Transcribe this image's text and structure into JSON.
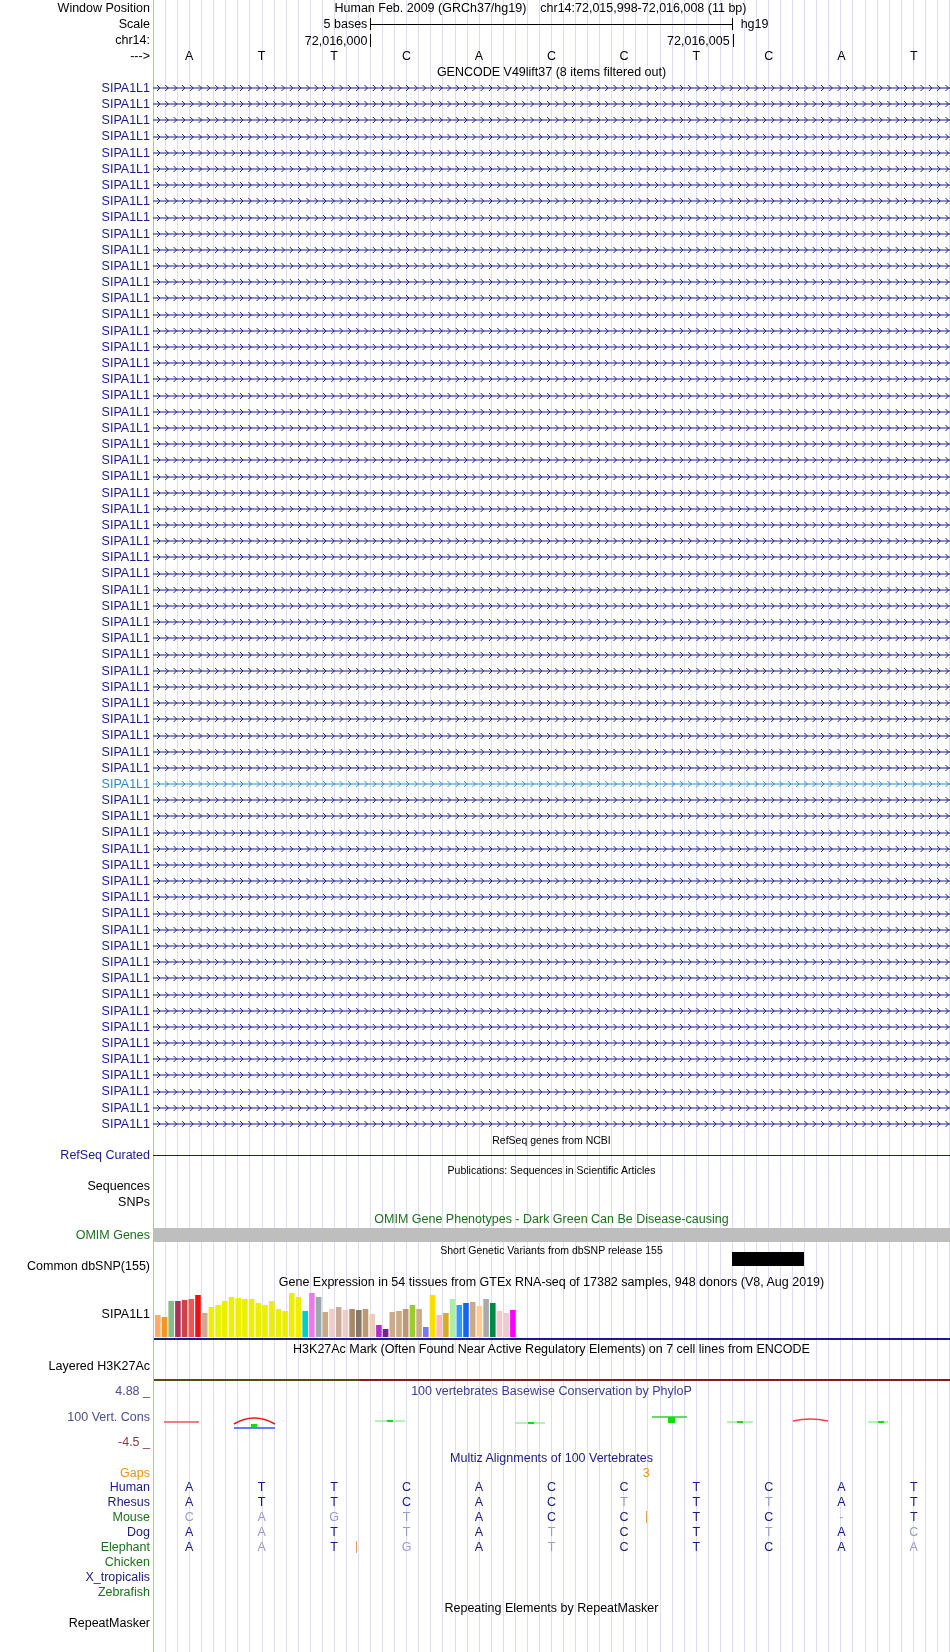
{
  "header": {
    "window_position_label": "Window Position",
    "assembly": "Human Feb. 2009 (GRCh37/hg19)",
    "position": "chr14:72,015,998-72,016,008 (11 bp)",
    "scale_label": "Scale",
    "scale_text": "5 bases",
    "scale_db": "hg19",
    "chrom_label": "chr14:",
    "ticks": [
      "72,016,000",
      "72,016,005"
    ],
    "strand_label": "--->",
    "bases": [
      "A",
      "T",
      "T",
      "C",
      "A",
      "C",
      "C",
      "T",
      "C",
      "A",
      "T"
    ]
  },
  "gencode": {
    "title": "GENCODE V49lift37 (8 items filtered out)",
    "genes": [
      {
        "name": "SIPA1L1",
        "selected": false
      },
      {
        "name": "SIPA1L1",
        "selected": false
      },
      {
        "name": "SIPA1L1",
        "selected": false
      },
      {
        "name": "SIPA1L1",
        "selected": false
      },
      {
        "name": "SIPA1L1",
        "selected": false
      },
      {
        "name": "SIPA1L1",
        "selected": false
      },
      {
        "name": "SIPA1L1",
        "selected": false
      },
      {
        "name": "SIPA1L1",
        "selected": false
      },
      {
        "name": "SIPA1L1",
        "selected": false
      },
      {
        "name": "SIPA1L1",
        "selected": false
      },
      {
        "name": "SIPA1L1",
        "selected": false
      },
      {
        "name": "SIPA1L1",
        "selected": false
      },
      {
        "name": "SIPA1L1",
        "selected": false
      },
      {
        "name": "SIPA1L1",
        "selected": false
      },
      {
        "name": "SIPA1L1",
        "selected": false
      },
      {
        "name": "SIPA1L1",
        "selected": false
      },
      {
        "name": "SIPA1L1",
        "selected": false
      },
      {
        "name": "SIPA1L1",
        "selected": false
      },
      {
        "name": "SIPA1L1",
        "selected": false
      },
      {
        "name": "SIPA1L1",
        "selected": false
      },
      {
        "name": "SIPA1L1",
        "selected": false
      },
      {
        "name": "SIPA1L1",
        "selected": false
      },
      {
        "name": "SIPA1L1",
        "selected": false
      },
      {
        "name": "SIPA1L1",
        "selected": false
      },
      {
        "name": "SIPA1L1",
        "selected": false
      },
      {
        "name": "SIPA1L1",
        "selected": false
      },
      {
        "name": "SIPA1L1",
        "selected": false
      },
      {
        "name": "SIPA1L1",
        "selected": false
      },
      {
        "name": "SIPA1L1",
        "selected": false
      },
      {
        "name": "SIPA1L1",
        "selected": false
      },
      {
        "name": "SIPA1L1",
        "selected": false
      },
      {
        "name": "SIPA1L1",
        "selected": false
      },
      {
        "name": "SIPA1L1",
        "selected": false
      },
      {
        "name": "SIPA1L1",
        "selected": false
      },
      {
        "name": "SIPA1L1",
        "selected": false
      },
      {
        "name": "SIPA1L1",
        "selected": false
      },
      {
        "name": "SIPA1L1",
        "selected": false
      },
      {
        "name": "SIPA1L1",
        "selected": false
      },
      {
        "name": "SIPA1L1",
        "selected": false
      },
      {
        "name": "SIPA1L1",
        "selected": false
      },
      {
        "name": "SIPA1L1",
        "selected": false
      },
      {
        "name": "SIPA1L1",
        "selected": false
      },
      {
        "name": "SIPA1L1",
        "selected": false
      },
      {
        "name": "SIPA1L1",
        "selected": true
      },
      {
        "name": "SIPA1L1",
        "selected": false
      },
      {
        "name": "SIPA1L1",
        "selected": false
      },
      {
        "name": "SIPA1L1",
        "selected": false
      },
      {
        "name": "SIPA1L1",
        "selected": false
      },
      {
        "name": "SIPA1L1",
        "selected": false
      },
      {
        "name": "SIPA1L1",
        "selected": false
      },
      {
        "name": "SIPA1L1",
        "selected": false
      },
      {
        "name": "SIPA1L1",
        "selected": false
      },
      {
        "name": "SIPA1L1",
        "selected": false
      },
      {
        "name": "SIPA1L1",
        "selected": false
      },
      {
        "name": "SIPA1L1",
        "selected": false
      },
      {
        "name": "SIPA1L1",
        "selected": false
      },
      {
        "name": "SIPA1L1",
        "selected": false
      },
      {
        "name": "SIPA1L1",
        "selected": false
      },
      {
        "name": "SIPA1L1",
        "selected": false
      },
      {
        "name": "SIPA1L1",
        "selected": false
      },
      {
        "name": "SIPA1L1",
        "selected": false
      },
      {
        "name": "SIPA1L1",
        "selected": false
      },
      {
        "name": "SIPA1L1",
        "selected": false
      },
      {
        "name": "SIPA1L1",
        "selected": false
      },
      {
        "name": "SIPA1L1",
        "selected": false
      }
    ]
  },
  "refseq": {
    "title": "RefSeq genes from NCBI",
    "label": "RefSeq Curated"
  },
  "publications": {
    "title": "Publications: Sequences in Scientific Articles",
    "labels": [
      "Sequences",
      "SNPs"
    ]
  },
  "omim": {
    "title": "OMIM Gene Phenotypes - Dark Green Can Be Disease-causing",
    "label": "OMIM Genes"
  },
  "dbsnp": {
    "title": "Short Genetic Variants from dbSNP release 155",
    "label": "Common dbSNP(155)"
  },
  "gtex": {
    "title": "Gene Expression in 54 tissues from GTEx RNA-seq of 17382 samples, 948 donors (V8, Aug 2019)",
    "label": "SIPA1L1"
  },
  "h3k27ac": {
    "title": "H3K27Ac Mark (Often Found Near Active Regulatory Elements) on 7 cell lines from ENCODE",
    "label": "Layered H3K27Ac"
  },
  "phylop": {
    "title": "100 vertebrates Basewise Conservation by PhyloP",
    "label": "100 Vert. Cons",
    "y_max": "4.88 _",
    "y_min": "-4.5 _"
  },
  "multiz": {
    "title": "Multiz Alignments of 100 Vertebrates",
    "gaps": {
      "label": "Gaps",
      "columns": [
        {},
        {},
        {},
        {},
        {},
        {},
        {
          "count": "3"
        },
        {},
        {},
        {},
        {}
      ]
    },
    "species": [
      {
        "name": "Human",
        "color": "#1a1a80",
        "bases": [
          {
            "b": "A",
            "faint": false,
            "insertion": false
          },
          {
            "b": "T",
            "faint": false,
            "insertion": false
          },
          {
            "b": "T",
            "faint": false,
            "insertion": false
          },
          {
            "b": "C",
            "faint": false,
            "insertion": false
          },
          {
            "b": "A",
            "faint": false,
            "insertion": false
          },
          {
            "b": "C",
            "faint": false,
            "insertion": false
          },
          {
            "b": "C",
            "faint": false,
            "insertion": false
          },
          {
            "b": "T",
            "faint": false,
            "insertion": false
          },
          {
            "b": "C",
            "faint": false,
            "insertion": false
          },
          {
            "b": "A",
            "faint": false,
            "insertion": false
          },
          {
            "b": "T",
            "faint": false,
            "insertion": false
          }
        ]
      },
      {
        "name": "Rhesus",
        "color": "#1a1a80",
        "bases": [
          {
            "b": "A",
            "faint": false,
            "insertion": false
          },
          {
            "b": "T",
            "faint": false,
            "insertion": false
          },
          {
            "b": "T",
            "faint": false,
            "insertion": false
          },
          {
            "b": "C",
            "faint": false,
            "insertion": false
          },
          {
            "b": "A",
            "faint": false,
            "insertion": false
          },
          {
            "b": "C",
            "faint": false,
            "insertion": false
          },
          {
            "b": "T",
            "faint": true,
            "insertion": false
          },
          {
            "b": "T",
            "faint": false,
            "insertion": false
          },
          {
            "b": "T",
            "faint": true,
            "insertion": false
          },
          {
            "b": "A",
            "faint": false,
            "insertion": false
          },
          {
            "b": "T",
            "faint": false,
            "insertion": false
          }
        ]
      },
      {
        "name": "Mouse",
        "color": "#1e6e1e",
        "bases": [
          {
            "b": "C",
            "faint": true,
            "insertion": false
          },
          {
            "b": "A",
            "faint": true,
            "insertion": false
          },
          {
            "b": "G",
            "faint": true,
            "insertion": false
          },
          {
            "b": "T",
            "faint": true,
            "insertion": false
          },
          {
            "b": "A",
            "faint": false,
            "insertion": false
          },
          {
            "b": "C",
            "faint": false,
            "insertion": false
          },
          {
            "b": "C",
            "faint": false,
            "insertion": true
          },
          {
            "b": "T",
            "faint": false,
            "insertion": false
          },
          {
            "b": "C",
            "faint": false,
            "insertion": false
          },
          {
            "b": "-",
            "faint": true,
            "insertion": false
          },
          {
            "b": "T",
            "faint": false,
            "insertion": false
          }
        ]
      },
      {
        "name": "Dog",
        "color": "#1a1a80",
        "bases": [
          {
            "b": "A",
            "faint": false,
            "insertion": false
          },
          {
            "b": "A",
            "faint": true,
            "insertion": false
          },
          {
            "b": "T",
            "faint": false,
            "insertion": false
          },
          {
            "b": "T",
            "faint": true,
            "insertion": false
          },
          {
            "b": "A",
            "faint": false,
            "insertion": false
          },
          {
            "b": "T",
            "faint": true,
            "insertion": false
          },
          {
            "b": "C",
            "faint": false,
            "insertion": false
          },
          {
            "b": "T",
            "faint": false,
            "insertion": false
          },
          {
            "b": "T",
            "faint": true,
            "insertion": false
          },
          {
            "b": "A",
            "faint": false,
            "insertion": false
          },
          {
            "b": "C",
            "faint": true,
            "insertion": false
          }
        ]
      },
      {
        "name": "Elephant",
        "color": "#1e6e1e",
        "bases": [
          {
            "b": "A",
            "faint": false,
            "insertion": false
          },
          {
            "b": "A",
            "faint": true,
            "insertion": false
          },
          {
            "b": "T",
            "faint": false,
            "insertion": true
          },
          {
            "b": "G",
            "faint": true,
            "insertion": false
          },
          {
            "b": "A",
            "faint": false,
            "insertion": false
          },
          {
            "b": "T",
            "faint": true,
            "insertion": false
          },
          {
            "b": "C",
            "faint": false,
            "insertion": false
          },
          {
            "b": "T",
            "faint": false,
            "insertion": false
          },
          {
            "b": "C",
            "faint": false,
            "insertion": false
          },
          {
            "b": "A",
            "faint": false,
            "insertion": false
          },
          {
            "b": "A",
            "faint": true,
            "insertion": false
          }
        ]
      },
      {
        "name": "Chicken",
        "color": "#1e6e1e"
      },
      {
        "name": "X_tropicalis",
        "color": "#1a1a80"
      },
      {
        "name": "Zebrafish",
        "color": "#1e6e1e"
      }
    ]
  },
  "repeatmasker": {
    "title": "Repeating Elements by RepeatMasker",
    "label": "RepeatMasker"
  }
}
